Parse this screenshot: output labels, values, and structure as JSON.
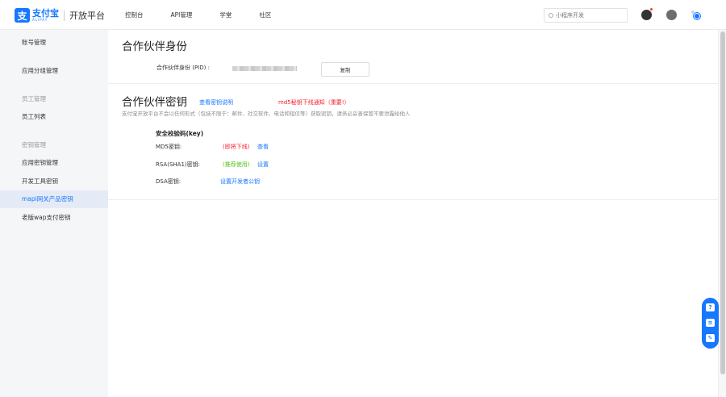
{
  "header": {
    "logo_cn": "支付宝",
    "logo_en": "ALIPAY",
    "platform": "开放平台",
    "nav": [
      "控制台",
      "API管理",
      "学堂",
      "社区"
    ],
    "search_placeholder": "小程序开发"
  },
  "sidebar": {
    "items": [
      {
        "label": "账号管理",
        "type": "item"
      },
      {
        "label": "应用分组管理",
        "type": "item"
      },
      {
        "label": "员工管理",
        "type": "group"
      },
      {
        "label": "员工列表",
        "type": "item"
      },
      {
        "label": "密钥管理",
        "type": "group"
      },
      {
        "label": "应用密钥管理",
        "type": "item"
      },
      {
        "label": "开发工具密钥",
        "type": "item"
      },
      {
        "label": "mapi网关产品密钥",
        "type": "item",
        "active": true
      },
      {
        "label": "老版wap支付密钥",
        "type": "item"
      }
    ]
  },
  "identity": {
    "title": "合作伙伴身份",
    "pid_label": "合作伙伴身份 (PID) :",
    "copy_button": "复制"
  },
  "keys": {
    "title": "合作伙伴密钥",
    "doc_link": "查看密钥说明",
    "notice": "md5秘钥下线通知（重要!）",
    "note": "支付宝开放平台不会以任何形式（包括不限于：邮件、社交软件、电话和短信等）获取密钥，请务必妥善保管不要泄露给他人",
    "section_title": "安全校验码(key)",
    "md5_label": "MD5密钥:",
    "md5_status": "(即将下线)",
    "md5_action": "查看",
    "rsa_label": "RSA(SHA1)密钥:",
    "rsa_status": "(推荐使用)",
    "rsa_action": "设置",
    "dsa_label": "DSA密钥:",
    "dsa_action": "设置开发者公钥"
  },
  "colors": {
    "brand": "#1677ff",
    "danger": "#f5222d",
    "success": "#52c41a"
  }
}
